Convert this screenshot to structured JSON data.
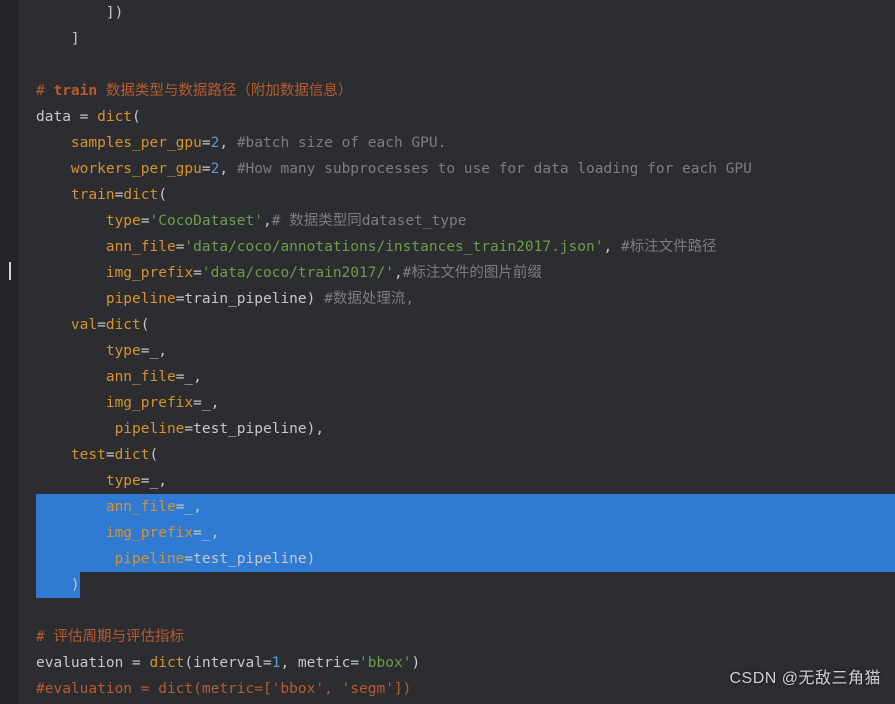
{
  "watermark": "CSDN @无敌三角猫",
  "code": {
    "l0": "        ])",
    "l1": "    ]",
    "raw2": "",
    "c_header_a": "# ",
    "c_header_b": "train",
    "c_header_c": " 数据类型与数据路径（附加数据信息）",
    "l3_a": "data ",
    "l3_eq": "=",
    "l3_b": " dict",
    "l3_p": "(",
    "l4_a": "    samples_per_gpu",
    "l4_eq": "=",
    "l4_n": "2",
    "l4_c": ", ",
    "l4_cmt": "#batch size of each GPU.",
    "l5_a": "    workers_per_gpu",
    "l5_eq": "=",
    "l5_n": "2",
    "l5_c": ", ",
    "l5_cmt": "#How many subprocesses to use for data loading for each GPU",
    "l6_a": "    train",
    "l6_eq": "=",
    "l6_b": "dict",
    "l6_p": "(",
    "l7_a": "        type",
    "l7_eq": "=",
    "l7_s": "'CocoDataset'",
    "l7_c": ",",
    "l7_cmt": "# 数据类型同dataset_type",
    "l8_a": "        ann_file",
    "l8_eq": "=",
    "l8_s": "'data/coco/annotations/instances_train2017.json'",
    "l8_c": ", ",
    "l8_cmt": "#标注文件路径",
    "l9_a": "        img_prefix",
    "l9_eq": "=",
    "l9_s": "'data/coco/train2017/'",
    "l9_c": ",",
    "l9_cmt": "#标注文件的图片前缀",
    "l10_a": "        pipeline",
    "l10_eq": "=",
    "l10_b": "train_pipeline) ",
    "l10_cmt": "#数据处理流,",
    "l11_a": "    val",
    "l11_eq": "=",
    "l11_b": "dict",
    "l11_p": "(",
    "l12_a": "        type",
    "l12_eq": "=",
    "l12_b": "_,",
    "l13_a": "        ann_file",
    "l13_eq": "=",
    "l13_b": "_,",
    "l14_a": "        img_prefix",
    "l14_eq": "=",
    "l14_b": "_,",
    "l15_a": "         pipeline",
    "l15_eq": "=",
    "l15_b": "test_pipeline),",
    "l16_a": "    test",
    "l16_eq": "=",
    "l16_b": "dict",
    "l16_p": "(",
    "l17_a": "        type",
    "l17_eq": "=",
    "l17_b": "_,",
    "l18_a": "        ann_file",
    "l18_eq": "=",
    "l18_b": "_,",
    "l19_a": "        img_prefix",
    "l19_eq": "=",
    "l19_b": "_,",
    "l20_a": "         pipeline",
    "l20_eq": "=",
    "l20_b": "test_pipeline)",
    "l21": "    )",
    "raw22": "",
    "c_eval": "# 评估周期与评估指标",
    "l23_a": "evaluation ",
    "l23_eq": "=",
    "l23_b": " dict",
    "l23_p": "(interval",
    "l23_eq2": "=",
    "l23_n": "1",
    "l23_c": ", metric",
    "l23_eq3": "=",
    "l23_s": "'bbox'",
    "l23_end": ")",
    "l24_cmt": "#evaluation = dict(metric=['bbox', 'segm'])"
  }
}
